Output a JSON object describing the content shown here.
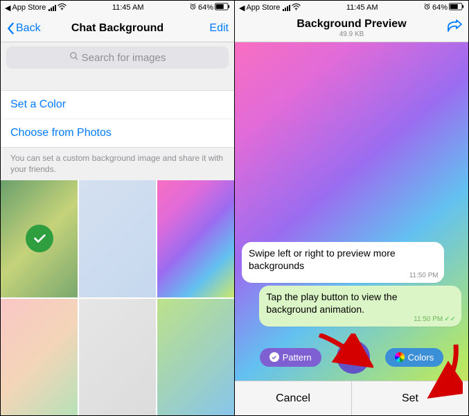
{
  "statusbar": {
    "back_app": "App Store",
    "time": "11:45 AM",
    "battery_pct": "64%"
  },
  "left": {
    "nav": {
      "back": "Back",
      "title": "Chat Background",
      "edit": "Edit"
    },
    "search_placeholder": "Search for images",
    "options": {
      "set_color": "Set a Color",
      "choose_photos": "Choose from Photos"
    },
    "hint": "You can set a custom background image and share it with your friends."
  },
  "right": {
    "nav": {
      "title": "Background Preview",
      "subtitle": "49.9 KB"
    },
    "messages": {
      "in": {
        "text": "Swipe left or right to preview more backgrounds",
        "time": "11:50 PM"
      },
      "out": {
        "text": "Tap the play button to view the background animation.",
        "time": "11:50 PM"
      }
    },
    "controls": {
      "pattern": "Pattern",
      "colors": "Colors"
    },
    "bottom": {
      "cancel": "Cancel",
      "set": "Set"
    }
  }
}
